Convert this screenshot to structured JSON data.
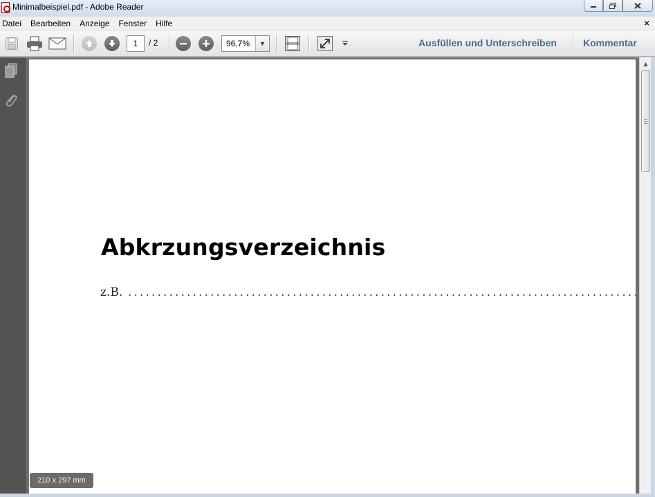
{
  "window": {
    "title": "Minimalbeispiel.pdf - Adobe Reader",
    "minimize_icon": "minimize-icon",
    "maximize_icon": "restore-icon",
    "close_icon": "close-icon"
  },
  "menu": {
    "items": [
      "Datei",
      "Bearbeiten",
      "Anzeige",
      "Fenster",
      "Hilfe"
    ],
    "close_doc": "×"
  },
  "toolbar": {
    "current_page": "1",
    "total_pages": "/ 2",
    "zoom": "96,7%",
    "fill_sign_label": "Ausfüllen und Unterschreiben",
    "comment_label": "Kommentar"
  },
  "document": {
    "heading": "Abkrzungsverzeichnis",
    "entry_abbr": "z.B.",
    "entry_dots": "........................................................................................................................",
    "page_size": "210 x 297 mm"
  },
  "colors": {
    "accent": "#4b6a8f",
    "viewer_bg": "#6f6f6f",
    "nav_bg": "#535353"
  }
}
